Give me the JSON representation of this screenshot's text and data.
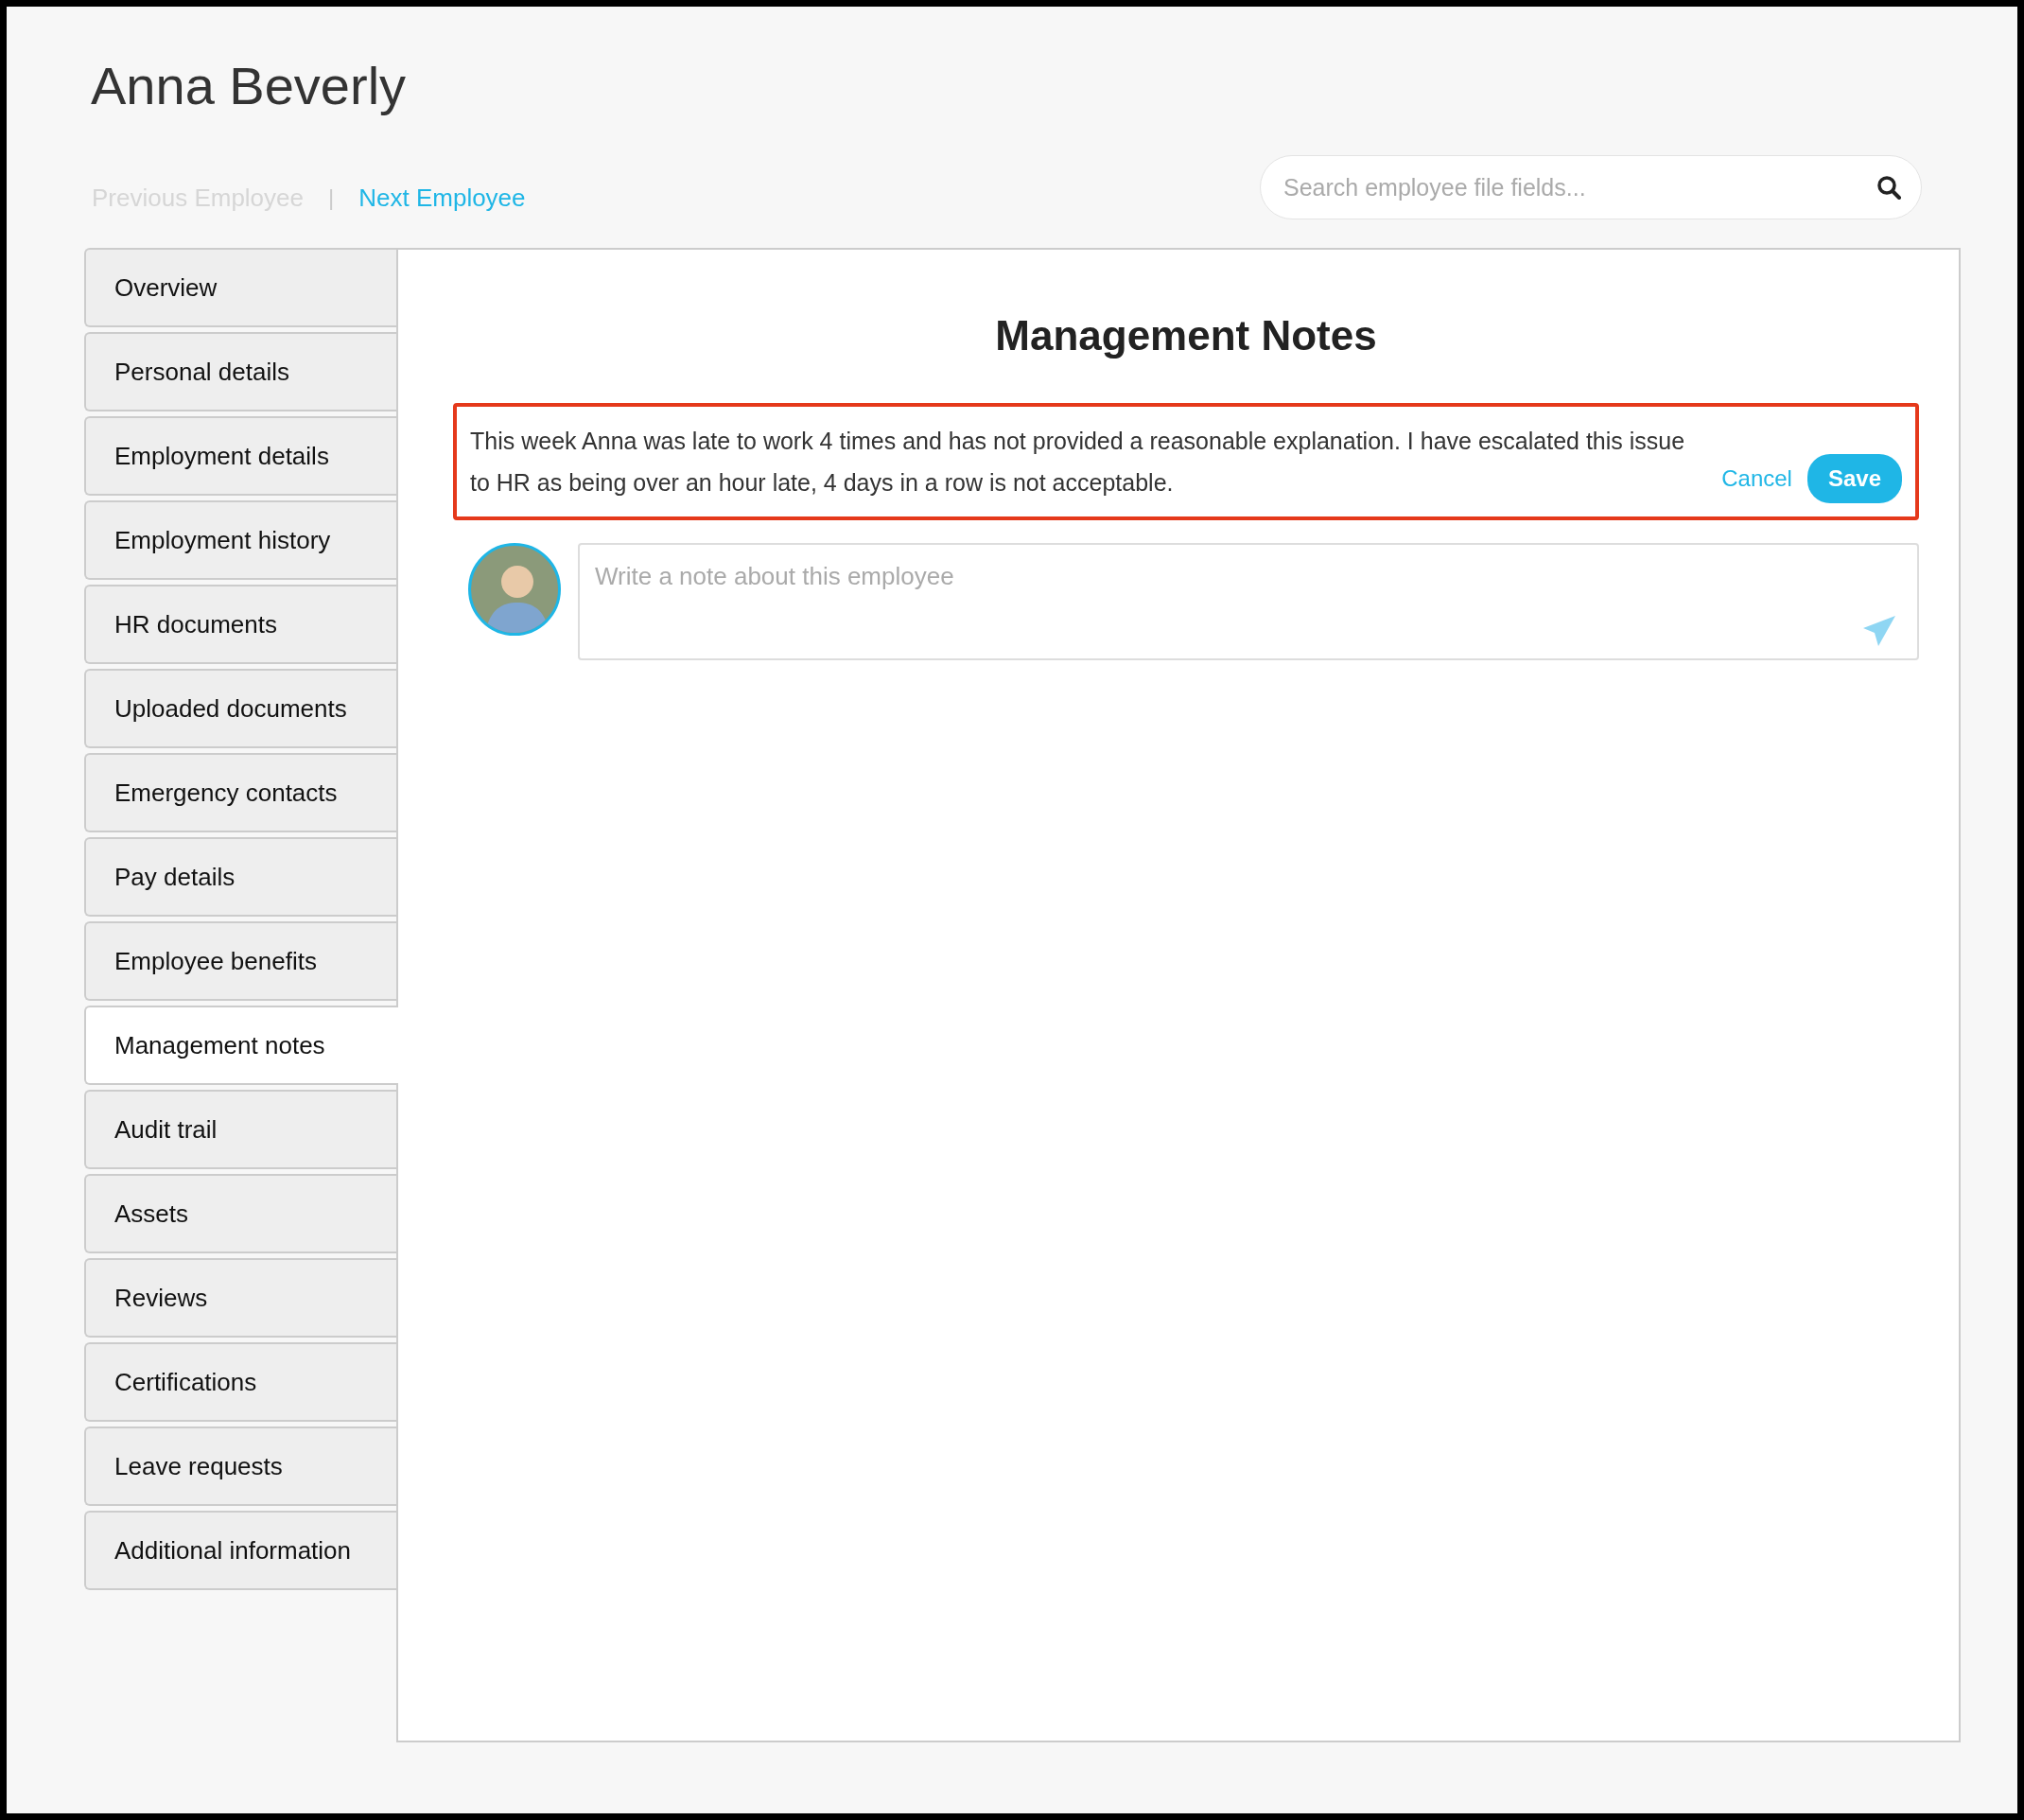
{
  "employee_name": "Anna Beverly",
  "navigation": {
    "previous": {
      "label": "Previous Employee",
      "disabled": true
    },
    "separator": "|",
    "next": {
      "label": "Next Employee",
      "disabled": false
    }
  },
  "search": {
    "placeholder": "Search employee file fields..."
  },
  "sidebar": {
    "items": [
      {
        "label": "Overview",
        "selected": false
      },
      {
        "label": "Personal details",
        "selected": false
      },
      {
        "label": "Employment details",
        "selected": false
      },
      {
        "label": "Employment history",
        "selected": false
      },
      {
        "label": "HR documents",
        "selected": false
      },
      {
        "label": "Uploaded documents",
        "selected": false
      },
      {
        "label": "Emergency contacts",
        "selected": false
      },
      {
        "label": "Pay details",
        "selected": false
      },
      {
        "label": "Employee benefits",
        "selected": false
      },
      {
        "label": "Management notes",
        "selected": true
      },
      {
        "label": "Audit trail",
        "selected": false
      },
      {
        "label": "Assets",
        "selected": false
      },
      {
        "label": "Reviews",
        "selected": false
      },
      {
        "label": "Certifications",
        "selected": false
      },
      {
        "label": "Leave requests",
        "selected": false
      },
      {
        "label": "Additional information",
        "selected": false
      }
    ]
  },
  "panel": {
    "title": "Management Notes",
    "editing_note": {
      "value": "This week Anna was late to work 4 times and has not provided a reasonable explanation. I have escalated this issue to HR as being over an hour late, 4 days in a row is not acceptable.",
      "cancel": "Cancel",
      "save": "Save"
    },
    "composer": {
      "placeholder": "Write a note about this employee"
    }
  }
}
